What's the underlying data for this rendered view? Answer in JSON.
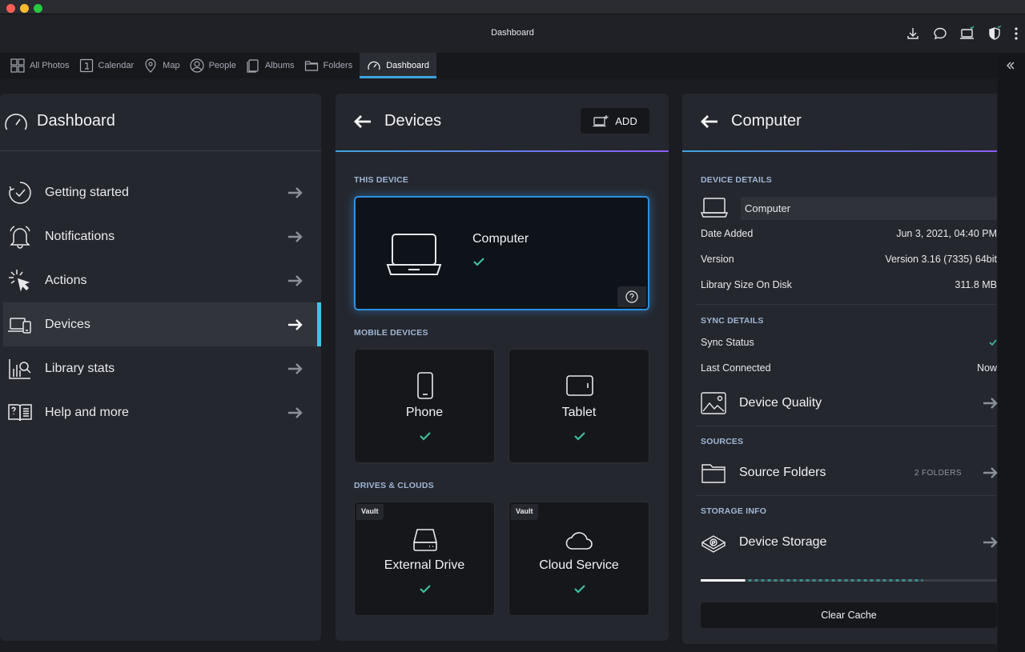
{
  "window": {
    "title": "Dashboard"
  },
  "tabs": [
    {
      "label": "All Photos",
      "icon": "grid-icon"
    },
    {
      "label": "Calendar",
      "icon": "calendar-icon"
    },
    {
      "label": "Map",
      "icon": "map-pin-icon"
    },
    {
      "label": "People",
      "icon": "person-icon"
    },
    {
      "label": "Albums",
      "icon": "album-icon"
    },
    {
      "label": "Folders",
      "icon": "folder-icon"
    },
    {
      "label": "Dashboard",
      "icon": "gauge-icon",
      "active": true
    }
  ],
  "sidebar": {
    "title": "Dashboard",
    "items": [
      {
        "label": "Getting started",
        "icon": "check-circle-icon"
      },
      {
        "label": "Notifications",
        "icon": "bell-icon"
      },
      {
        "label": "Actions",
        "icon": "cursor-click-icon"
      },
      {
        "label": "Devices",
        "icon": "devices-icon",
        "active": true
      },
      {
        "label": "Library stats",
        "icon": "chart-search-icon"
      },
      {
        "label": "Help and more",
        "icon": "book-help-icon"
      }
    ]
  },
  "devices": {
    "title": "Devices",
    "add_label": "ADD",
    "this_device_label": "THIS DEVICE",
    "this_device_name": "Computer",
    "mobile_label": "MOBILE DEVICES",
    "mobile": [
      {
        "name": "Phone",
        "icon": "phone-icon"
      },
      {
        "name": "Tablet",
        "icon": "tablet-icon"
      }
    ],
    "drives_label": "DRIVES & CLOUDS",
    "drives": [
      {
        "name": "External Drive",
        "badge": "Vault",
        "icon": "drive-icon"
      },
      {
        "name": "Cloud Service",
        "badge": "Vault",
        "icon": "cloud-icon"
      }
    ]
  },
  "computer": {
    "title": "Computer",
    "details_label": "DEVICE DETAILS",
    "name_value": "Computer",
    "date_added_label": "Date Added",
    "date_added_value": "Jun 3, 2021, 04:40 PM",
    "version_label": "Version",
    "version_value": "Version 3.16 (7335) 64bit",
    "size_label": "Library Size On Disk",
    "size_value": "311.8 MB",
    "sync_label": "SYNC DETAILS",
    "sync_status_label": "Sync Status",
    "last_connected_label": "Last Connected",
    "last_connected_value": "Now",
    "device_quality_label": "Device Quality",
    "sources_label": "SOURCES",
    "source_folders_label": "Source Folders",
    "source_folders_count": "2 FOLDERS",
    "storage_label": "STORAGE INFO",
    "device_storage_label": "Device Storage",
    "storage_used_fraction": 0.15,
    "storage_pending_fraction": 0.6,
    "clear_cache_label": "Clear Cache"
  },
  "colors": {
    "accent_blue": "#3ea3dc",
    "accent_purple": "#8b5cf6",
    "check_green": "#3fbf9f",
    "active_bar": "#3ec3e8"
  }
}
